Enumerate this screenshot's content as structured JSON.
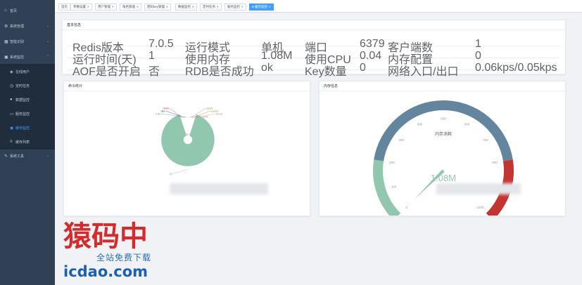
{
  "sidebar": {
    "items": [
      {
        "label": "首页",
        "icon": "home-icon"
      },
      {
        "label": "系统管理",
        "icon": "gear-icon"
      },
      {
        "label": "智能识别",
        "icon": "scan-icon"
      },
      {
        "label": "系统监控",
        "icon": "monitor-icon"
      },
      {
        "label": "在线用户",
        "icon": "users-icon"
      },
      {
        "label": "定时任务",
        "icon": "clock-icon"
      },
      {
        "label": "数据监控",
        "icon": "database-icon"
      },
      {
        "label": "服务监控",
        "icon": "server-icon"
      },
      {
        "label": "缓存监控",
        "icon": "cache-icon"
      },
      {
        "label": "缓存列表",
        "icon": "list-icon"
      },
      {
        "label": "系统工具",
        "icon": "tool-icon"
      }
    ]
  },
  "tags": [
    {
      "label": "首页"
    },
    {
      "label": "参数设置"
    },
    {
      "label": "用户管理"
    },
    {
      "label": "角色管理"
    },
    {
      "label": "密码key管理"
    },
    {
      "label": "数据监控"
    },
    {
      "label": "定时任务"
    },
    {
      "label": "服务监控"
    },
    {
      "label": "缓存监控"
    }
  ],
  "basic_info": {
    "title": "基本信息",
    "rows": [
      [
        "Redis版本",
        "7.0.5",
        "运行模式",
        "单机",
        "端口",
        "6379",
        "客户端数",
        "1"
      ],
      [
        "运行时间(天)",
        "1",
        "使用内存",
        "1.08M",
        "使用CPU",
        "0.04",
        "内存配置",
        "0"
      ],
      [
        "AOF是否开启",
        "否",
        "RDB是否成功",
        "ok",
        "Key数量",
        "0",
        "网络入口/出口",
        "0.06kps/0.05kps"
      ]
    ]
  },
  "command_stats": {
    "title": "命令统计",
    "legend_labels": [
      "hello",
      "del",
      "info",
      "auth",
      "keys",
      "exists",
      "delete",
      "get"
    ]
  },
  "memory_info": {
    "title": "内存信息",
    "gauge_name": "内存消耗",
    "gauge_value": "1.08M",
    "ticks": [
      "0",
      "100",
      "200",
      "300",
      "400",
      "500",
      "600",
      "700",
      "800",
      "900",
      "1000"
    ]
  },
  "chart_data": [
    {
      "type": "pie",
      "title": "命令统计",
      "labels": [
        "get",
        "hello",
        "del",
        "info",
        "auth",
        "keys",
        "exists",
        "delete"
      ],
      "values": [
        90,
        2,
        1.5,
        1.5,
        1.5,
        1.2,
        1.2,
        1.1
      ]
    },
    {
      "type": "gauge",
      "title": "内存信息",
      "name": "内存消耗",
      "value": 1.08,
      "value_label": "1.08M",
      "min": 0,
      "max": 1000,
      "ticks": [
        0,
        100,
        200,
        300,
        400,
        500,
        600,
        700,
        800,
        900,
        1000
      ]
    }
  ],
  "watermark": {
    "logo_text": "猿码中",
    "tagline": "全站免费下载",
    "url": "icdao.com"
  }
}
